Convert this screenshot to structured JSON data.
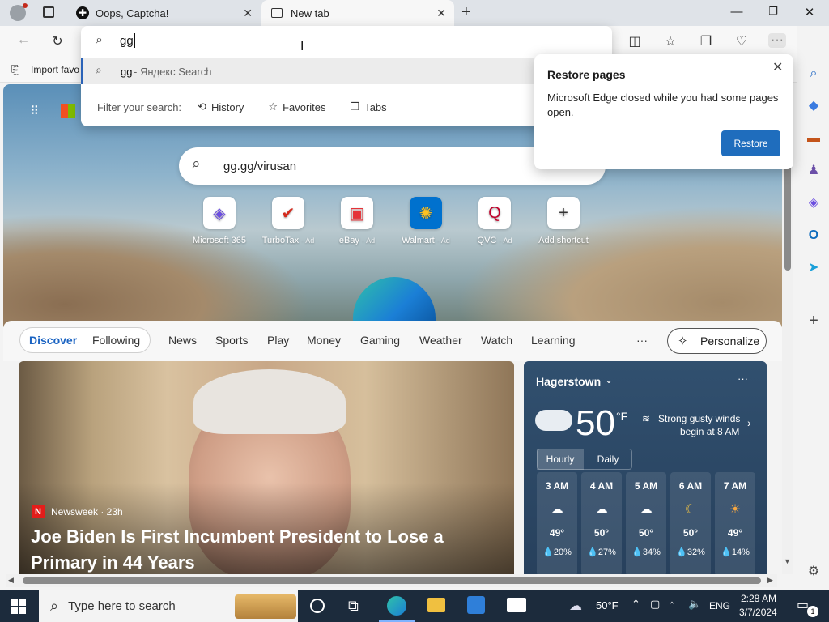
{
  "tabs": [
    {
      "title": "Oops, Captcha!"
    },
    {
      "title": "New tab"
    }
  ],
  "window_controls": {
    "minimize": "—",
    "restore": "❐",
    "close": "✕"
  },
  "address": {
    "value": "gg",
    "suggestion_term": "gg",
    "suggestion_engine": " - Яндекс Search",
    "filter_label": "Filter your search:",
    "filters": [
      "History",
      "Favorites",
      "Tabs"
    ]
  },
  "favbar": {
    "import_label": "Import favo"
  },
  "search": {
    "value": "gg.gg/virusan"
  },
  "tiles": [
    {
      "label": "Microsoft 365",
      "ad": ""
    },
    {
      "label": "TurboTax",
      "ad": "· Ad"
    },
    {
      "label": "eBay",
      "ad": "· Ad"
    },
    {
      "label": "Walmart",
      "ad": "· Ad"
    },
    {
      "label": "QVC",
      "ad": "· Ad"
    },
    {
      "label": "Add shortcut",
      "ad": ""
    }
  ],
  "feed": {
    "discover": "Discover",
    "following": "Following",
    "categories": [
      "News",
      "Sports",
      "Play",
      "Money",
      "Gaming",
      "Weather",
      "Watch",
      "Learning"
    ],
    "more": "···",
    "personalize": "Personalize"
  },
  "news": {
    "source": "Newsweek · 23h",
    "headline_line1": "Joe Biden Is First Incumbent President to Lose a",
    "headline_line2": "Primary in 44 Years"
  },
  "weather": {
    "city": "Hagerstown",
    "temp": "50",
    "unit": "°F",
    "alert_line1": "Strong gusty winds",
    "alert_line2": "begin at 8 AM",
    "tab_hourly": "Hourly",
    "tab_daily": "Daily",
    "hours": [
      {
        "time": "3 AM",
        "temp": "49°",
        "rain": "20%"
      },
      {
        "time": "4 AM",
        "temp": "50°",
        "rain": "27%"
      },
      {
        "time": "5 AM",
        "temp": "50°",
        "rain": "34%"
      },
      {
        "time": "6 AM",
        "temp": "50°",
        "rain": "32%"
      },
      {
        "time": "7 AM",
        "temp": "49°",
        "rain": "14%"
      }
    ]
  },
  "restore": {
    "title": "Restore pages",
    "body": "Microsoft Edge closed while you had some pages open.",
    "button": "Restore"
  },
  "taskbar": {
    "search_placeholder": "Type here to search",
    "weather": "50°F",
    "lang": "ENG",
    "time": "2:28 AM",
    "date": "3/7/2024",
    "notif_count": "1"
  }
}
